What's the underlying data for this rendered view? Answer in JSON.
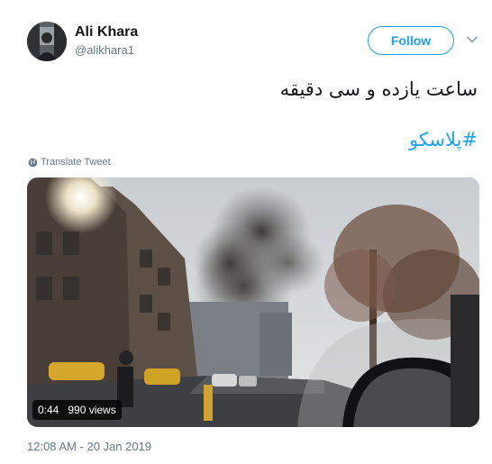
{
  "user": {
    "name": "Ali Khara",
    "handle": "@alikhara1"
  },
  "actions": {
    "follow_label": "Follow"
  },
  "tweet": {
    "text": "ساعت یازده و سی دقیقه",
    "hashtag": "#پلاسکو",
    "translate_label": "Translate Tweet",
    "timestamp": "12:08 AM - 20 Jan 2019"
  },
  "media": {
    "duration": "0:44",
    "views": "990 views"
  },
  "colors": {
    "accent": "#1da1f2",
    "secondary_text": "#657786"
  }
}
